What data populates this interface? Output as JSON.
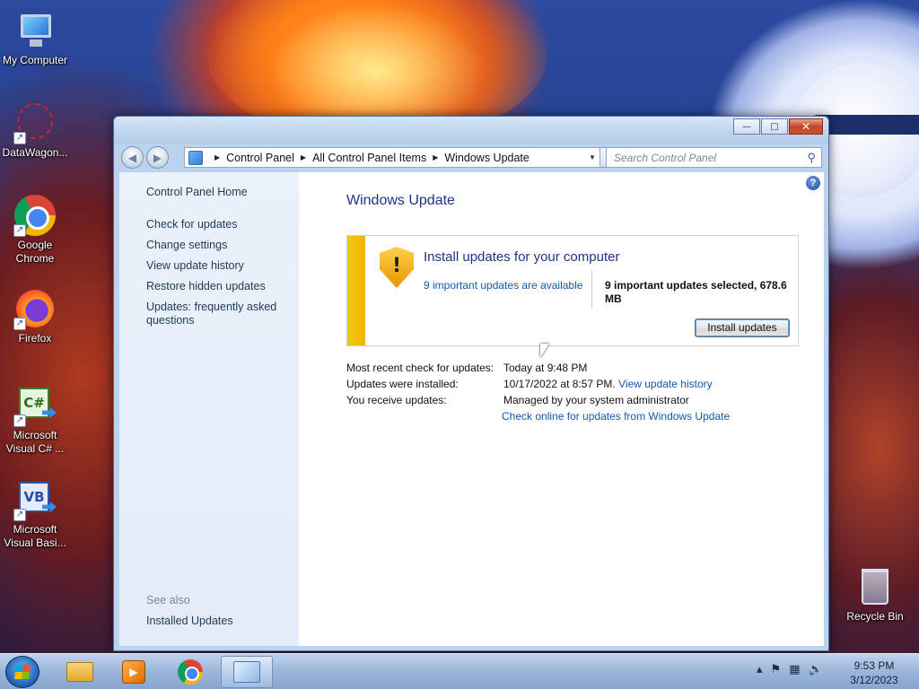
{
  "desktop": {
    "icons": [
      {
        "label": "My Computer",
        "icon": "computer-icon"
      },
      {
        "label": "DataWagon...",
        "icon": "datawagon-icon"
      },
      {
        "label": "Google Chrome",
        "icon": "chrome-icon"
      },
      {
        "label": "Firefox",
        "icon": "firefox-icon"
      },
      {
        "label": "Microsoft Visual C# ...",
        "icon": "visual-csharp-icon",
        "glyph": "C#"
      },
      {
        "label": "Microsoft Visual Basi...",
        "icon": "visual-basic-icon",
        "glyph": "VB"
      },
      {
        "label": "Recycle Bin",
        "icon": "recycle-bin-icon"
      }
    ]
  },
  "window": {
    "title_buttons": {
      "minimize": "—",
      "maximize": "□",
      "close": "✕"
    },
    "breadcrumb": [
      "Control Panel",
      "All Control Panel Items",
      "Windows Update"
    ],
    "search_placeholder": "Search Control Panel",
    "left_pane": {
      "home": "Control Panel Home",
      "links": [
        "Check for updates",
        "Change settings",
        "View update history",
        "Restore hidden updates",
        "Updates: frequently asked questions"
      ],
      "see_also": "See also",
      "see_also_links": [
        "Installed Updates"
      ]
    },
    "main": {
      "title": "Windows Update",
      "update_box": {
        "heading": "Install updates for your computer",
        "available_link": "9 important updates are available",
        "selected": "9 important updates selected, 678.6 MB",
        "install_button": "Install updates",
        "shield_glyph": "!"
      },
      "info": [
        {
          "label": "Most recent check for updates:",
          "value": "Today at 9:48 PM"
        },
        {
          "label": "Updates were installed:",
          "value": "10/17/2022 at 8:57 PM.",
          "link": "View update history"
        },
        {
          "label": "You receive updates:",
          "value": "Managed by your system administrator"
        }
      ],
      "check_online_link": "Check online for updates from Windows Update"
    }
  },
  "taskbar": {
    "apps": [
      "windows-explorer-icon",
      "media-player-icon",
      "chrome-icon",
      "control-panel-icon"
    ],
    "active_app": "control-panel-icon",
    "tray_icons": [
      "show-hidden-icons-arrow",
      "action-center-flag-icon",
      "network-icon",
      "volume-icon"
    ],
    "clock": {
      "time": "9:53 PM",
      "date": "3/12/2023"
    }
  },
  "colors": {
    "title_blue": "#1e3287",
    "link_blue": "#1558b0",
    "warning_stripe": "#f0b400"
  }
}
